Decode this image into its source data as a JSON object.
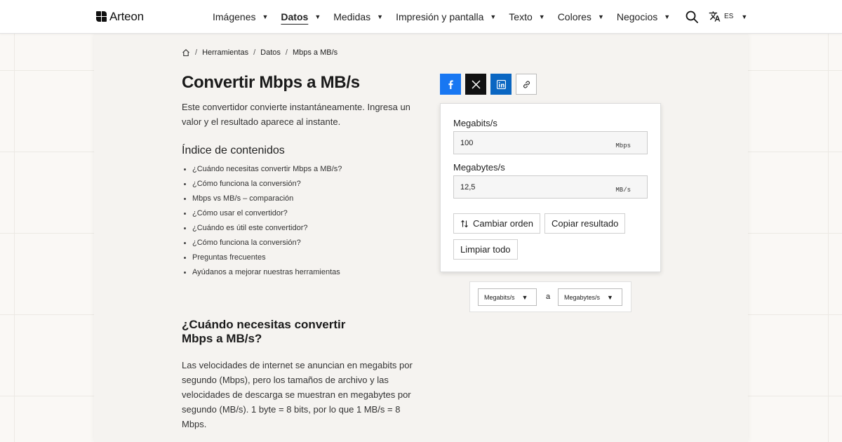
{
  "brand": {
    "name": "Arteon"
  },
  "nav": {
    "items": [
      {
        "label": "Imágenes",
        "active": false
      },
      {
        "label": "Datos",
        "active": true
      },
      {
        "label": "Medidas",
        "active": false
      },
      {
        "label": "Impresión y pantalla",
        "active": false
      },
      {
        "label": "Texto",
        "active": false
      },
      {
        "label": "Colores",
        "active": false
      },
      {
        "label": "Negocios",
        "active": false
      }
    ],
    "lang": "ES"
  },
  "breadcrumb": {
    "items": [
      "Herramientas",
      "Datos",
      "Mbps a MB/s"
    ]
  },
  "page": {
    "title": "Convertir Mbps a MB/s",
    "intro": "Este convertidor convierte instantáneamente. Ingresa un valor y el resultado aparece al instante.",
    "toc_title": "Índice de contenidos",
    "toc": [
      "¿Cuándo necesitas convertir Mbps a MB/s?",
      "¿Cómo funciona la conversión?",
      "Mbps vs MB/s – comparación",
      "¿Cómo usar el convertidor?",
      "¿Cuándo es útil este convertidor?",
      "¿Cómo funciona la conversión?",
      "Preguntas frecuentes",
      "Ayúdanos a mejorar nuestras herramientas"
    ],
    "section_title": "¿Cuándo necesitas convertir Mbps a MB/s?",
    "section_body": "Las velocidades de internet se anuncian en megabits por segundo (Mbps), pero los tamaños de archivo y las velocidades de descarga se muestran en megabytes por segundo (MB/s). 1 byte = 8 bits, por lo que 1 MB/s = 8 Mbps."
  },
  "converter": {
    "from_label": "Megabits/s",
    "from_value": "100",
    "from_unit": "Mbps",
    "to_label": "Megabytes/s",
    "to_value": "12,5",
    "to_unit": "MB/s",
    "swap_label": "Cambiar orden",
    "copy_label": "Copiar resultado",
    "clear_label": "Limpiar todo"
  },
  "unit_selector": {
    "from": "Megabits/s",
    "connector": "a",
    "to": "Megabytes/s"
  },
  "share": {
    "icons": [
      "facebook-icon",
      "x-icon",
      "linkedin-icon",
      "link-icon"
    ],
    "colors": {
      "facebook": "#1877f2",
      "x": "#111111",
      "linkedin": "#0a66c2"
    }
  }
}
